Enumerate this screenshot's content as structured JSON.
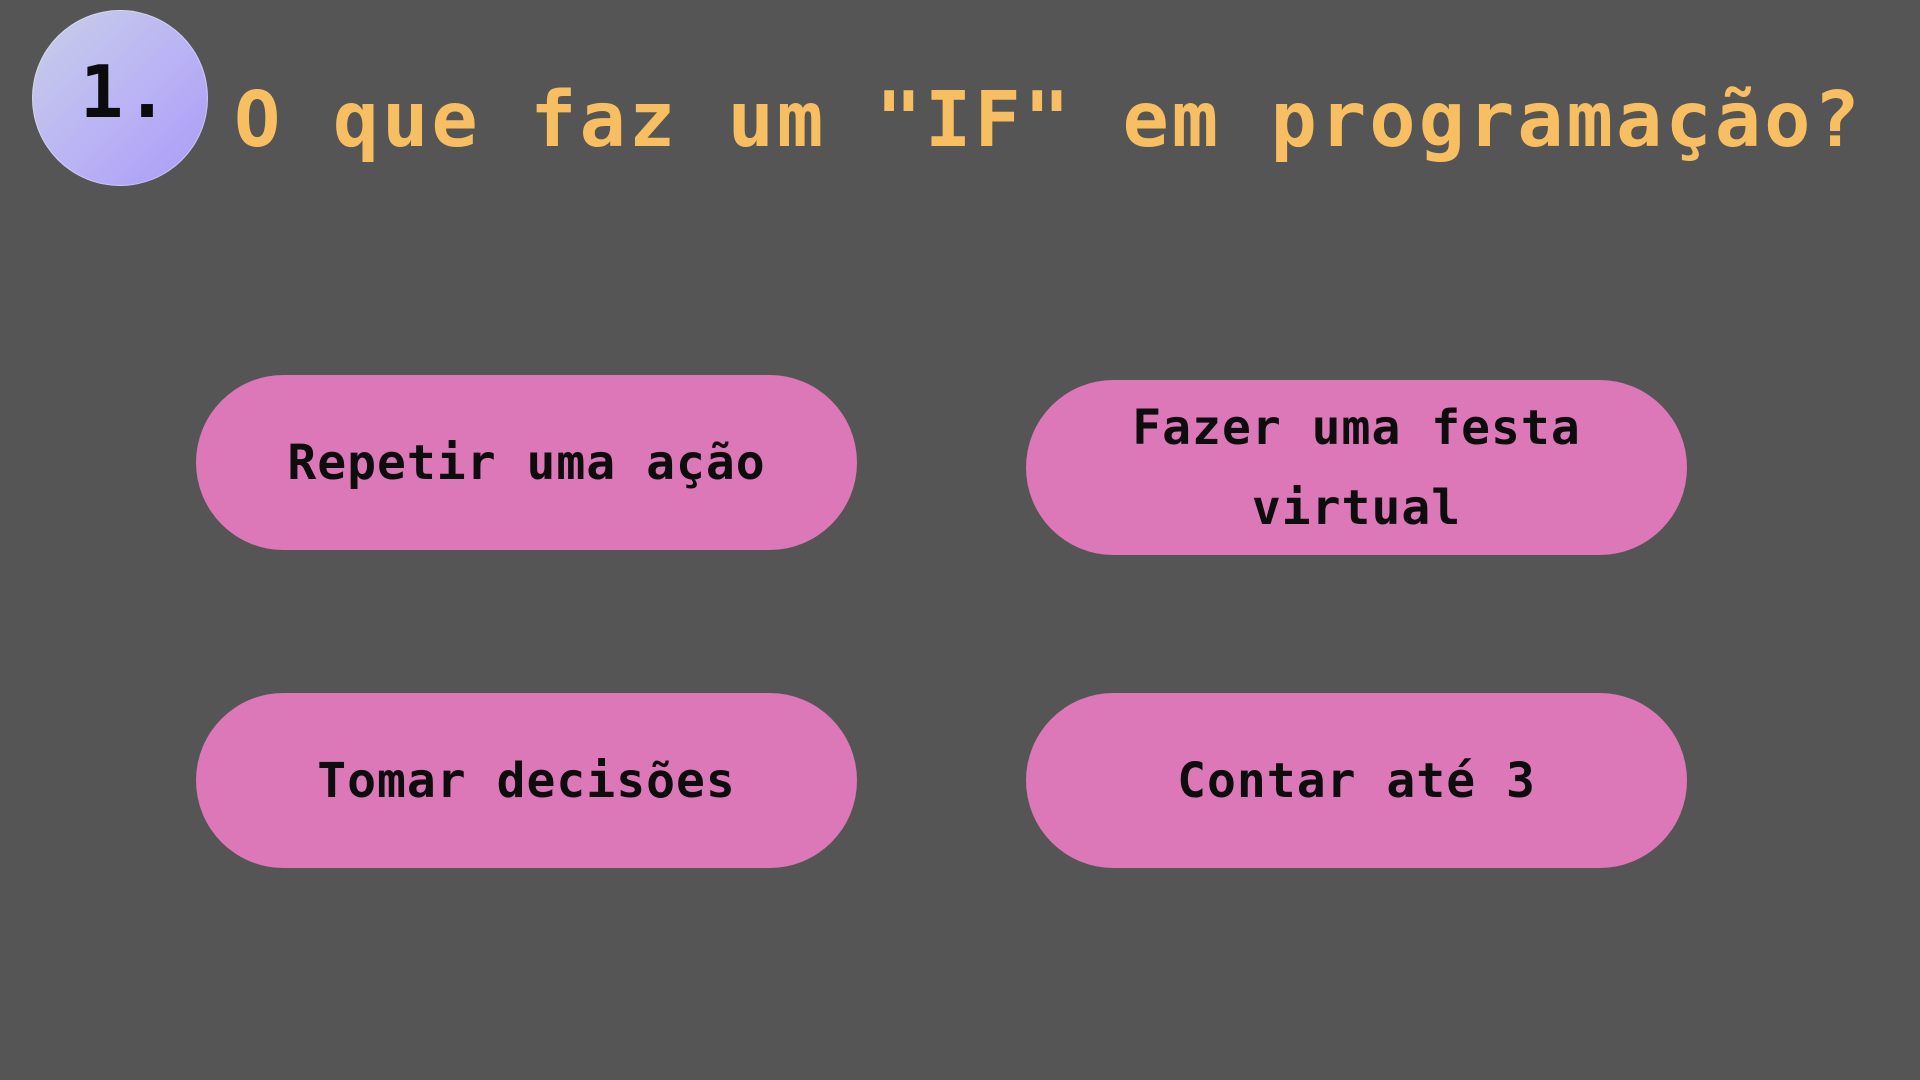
{
  "question": {
    "number": "1.",
    "text": "O que faz um \"IF\" em programação?"
  },
  "options": [
    {
      "label": "Repetir uma ação"
    },
    {
      "label": "Fazer uma festa virtual"
    },
    {
      "label": "Tomar decisões"
    },
    {
      "label": "Contar até 3"
    }
  ],
  "colors": {
    "background": "#555555",
    "question_text": "#f7bf62",
    "option_fill": "#dc78b8",
    "badge_gradient_start": "#c9cfe9",
    "badge_gradient_end": "#a99af7"
  }
}
